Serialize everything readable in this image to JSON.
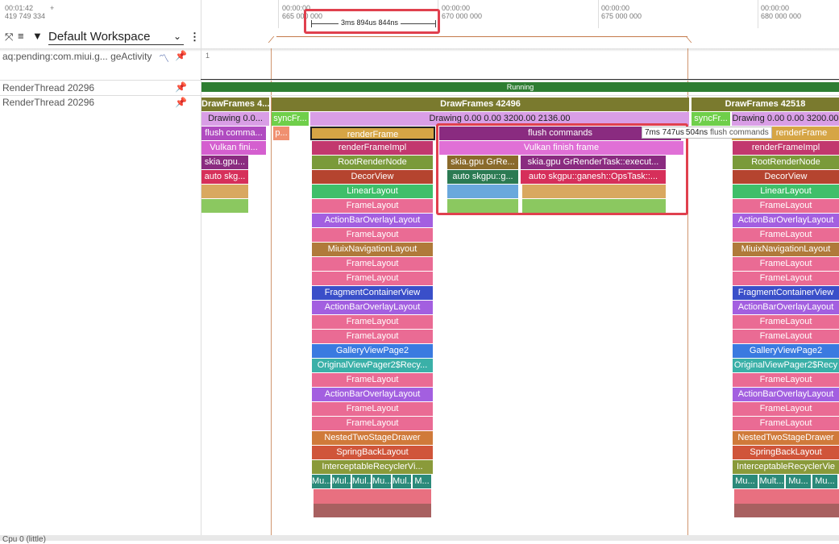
{
  "timeline": {
    "top_left_time": "00:01:42",
    "top_left_sub": "419 749 334",
    "top_plus": "+",
    "ticks": [
      {
        "time": "00:00:00",
        "ns": "665 000 000"
      },
      {
        "time": "00:00:00",
        "ns": "670 000 000"
      },
      {
        "time": "00:00:00",
        "ns": "675 000 000"
      },
      {
        "time": "00:00:00",
        "ns": "680 000 000"
      }
    ],
    "measure": "3ms 894us 844ns"
  },
  "workspace": {
    "title": "Default Workspace"
  },
  "tracks": {
    "activity_label": "aq:pending:com.miui.g... geActivity",
    "activity_value": "1",
    "render1": "RenderThread 20296",
    "render2": "RenderThread 20296",
    "running": "Running",
    "bottom_label": "Cpu 0 (little)"
  },
  "tooltip": {
    "duration": "7ms 747us",
    "suffix": "504ns",
    "name": "flush commands"
  },
  "slices": {
    "df_left": "DrawFrames 4...",
    "df_mid": "DrawFrames 42496",
    "df_right": "DrawFrames 42518",
    "drawing_left": "Drawing  0.0...",
    "syncfr_mid": "syncFr...",
    "drawing_mid": "Drawing  0.00  0.00 3200.00 2136.00",
    "syncfr_right": "syncFr...",
    "drawing_right": "Drawing  0.00  0.00 3200.00",
    "flush_left": "flush comma...",
    "vulkan_left": "Vulkan fini...",
    "skia_left": "skia.gpu...",
    "auto_left": "auto skg...",
    "p_small": "p...",
    "renderframe": "renderFrame",
    "flush_commands": "flush commands",
    "vulkan_finish": "Vulkan finish frame",
    "skia_gre": "skia.gpu GrRe...",
    "skia_task": "skia.gpu GrRenderTask::execut...",
    "auto_skgpu_g": "auto skgpu::g...",
    "auto_skgpu_ops": "auto skgpu::ganesh::OpsTask::...",
    "stack": [
      "renderFrameImpl",
      "RootRenderNode",
      "DecorView",
      "LinearLayout",
      "FrameLayout",
      "ActionBarOverlayLayout",
      "FrameLayout",
      "MiuixNavigationLayout",
      "FrameLayout",
      "FrameLayout",
      "FragmentContainerView",
      "ActionBarOverlayLayout",
      "FrameLayout",
      "FrameLayout",
      "GalleryViewPage2",
      "OriginalViewPager2$Recy...",
      "FrameLayout",
      "ActionBarOverlayLayout",
      "FrameLayout",
      "FrameLayout",
      "NestedTwoStageDrawer",
      "SpringBackLayout",
      "InterceptableRecyclerVi..."
    ],
    "stack_right": [
      "renderFrameImpl",
      "RootRenderNode",
      "DecorView",
      "LinearLayout",
      "FrameLayout",
      "ActionBarOverlayLayout",
      "FrameLayout",
      "MiuixNavigationLayout",
      "FrameLayout",
      "FrameLayout",
      "FragmentContainerView",
      "ActionBarOverlayLayout",
      "FrameLayout",
      "FrameLayout",
      "GalleryViewPage2",
      "OriginalViewPager2$Recy",
      "FrameLayout",
      "ActionBarOverlayLayout",
      "FrameLayout",
      "FrameLayout",
      "NestedTwoStageDrawer",
      "SpringBackLayout",
      "InterceptableRecyclerVie"
    ],
    "renderframe_right": "renderFrame",
    "mul": [
      "Mu...",
      "Mul...",
      "Mul...",
      "Mu...",
      "Mul...",
      "M..."
    ],
    "mul_right": [
      "Mu...",
      "Mult...",
      "Mu...",
      "Mu..."
    ]
  },
  "colors": {
    "drawframes": "#7a7a2e",
    "drawing": "#d99ee6",
    "running": "#2e7d32",
    "highlight": "#e0404e",
    "renderframe": "#d6a545"
  }
}
